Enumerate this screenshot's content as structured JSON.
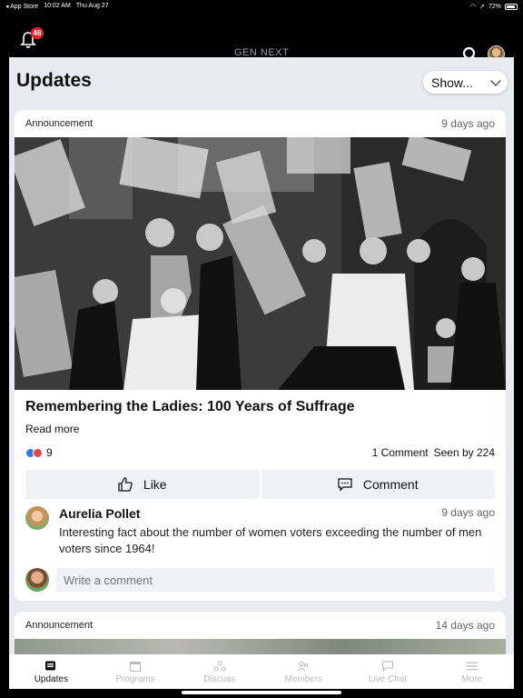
{
  "status": {
    "app": "◂ App Store",
    "time": "10:02 AM",
    "date": "Thu Aug 27",
    "battery": "72%"
  },
  "nav": {
    "badge_count": "46",
    "logo": "GEN NEXT"
  },
  "page": {
    "title": "Updates",
    "show_label": "Show..."
  },
  "posts": [
    {
      "type": "Announcement",
      "time": "9 days ago",
      "title": "Remembering the Ladies: 100 Years of Suffrage",
      "read_more": "Read more",
      "reaction_count": "9",
      "comment_count": "1 Comment",
      "seen_by": "Seen by 224",
      "like_label": "Like",
      "comment_label": "Comment",
      "comment": {
        "author": "Aurelia Pollet",
        "time": "9 days ago",
        "text": "Interesting fact about the number of women voters exceeding the number of men voters since 1964!"
      },
      "write_placeholder": "Write a comment"
    },
    {
      "type": "Announcement",
      "time": "14 days ago"
    }
  ],
  "tabs": [
    {
      "label": "Updates",
      "icon": "updates-icon"
    },
    {
      "label": "Programs",
      "icon": "calendar-icon"
    },
    {
      "label": "Discuss",
      "icon": "discuss-icon"
    },
    {
      "label": "Members",
      "icon": "members-icon"
    },
    {
      "label": "Live Chat",
      "icon": "chat-icon"
    },
    {
      "label": "More",
      "icon": "menu-icon"
    }
  ],
  "colors": {
    "accent_badge": "#e0262b",
    "background": "#e7eaf1",
    "like": "#2e7be6",
    "love": "#e8454a"
  }
}
